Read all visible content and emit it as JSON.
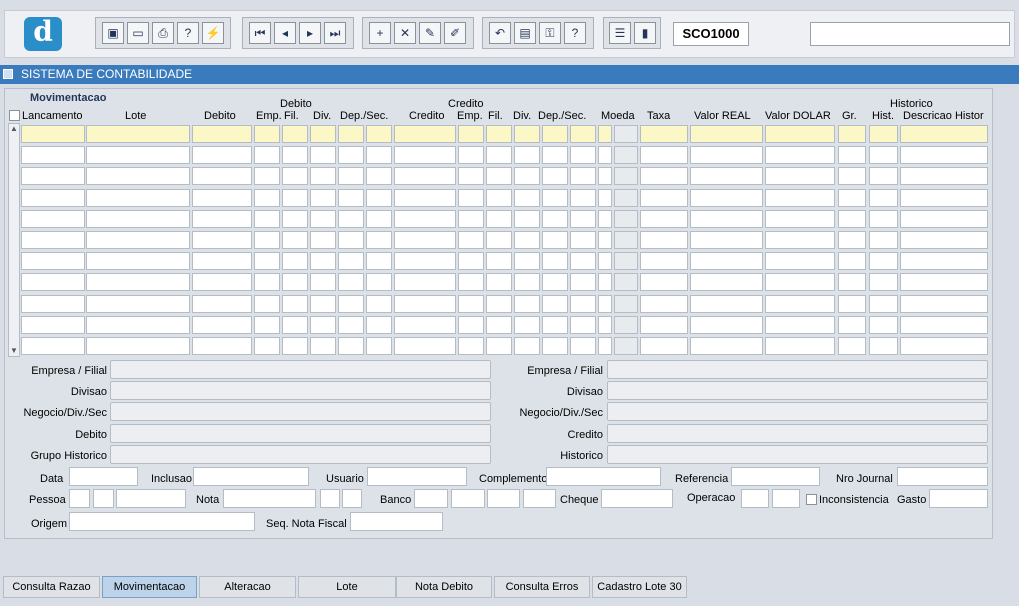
{
  "toolbar": {
    "logo_letter": "d",
    "form_id": "SCO1000",
    "groups": [
      {
        "name": "file-group",
        "buttons": [
          "save-icon",
          "window-icon",
          "print-icon",
          "help-query-icon",
          "magic-wand-icon"
        ]
      },
      {
        "name": "nav-group",
        "buttons": [
          "first-record-icon",
          "prev-record-icon",
          "next-record-icon",
          "last-record-icon"
        ]
      },
      {
        "name": "record-group",
        "buttons": [
          "insert-record-icon",
          "delete-record-icon",
          "edit-record-icon",
          "clear-record-icon"
        ]
      },
      {
        "name": "misc-group",
        "buttons": [
          "undo-icon",
          "clipboard-icon",
          "key-icon",
          "help-icon"
        ]
      },
      {
        "name": "exit-group",
        "buttons": [
          "menu-icon",
          "exit-door-icon"
        ]
      }
    ]
  },
  "title": "SISTEMA DE CONTABILIDADE",
  "section_title": "Movimentacao",
  "grid": {
    "group_headers": {
      "debito": "Debito",
      "credito": "Credito",
      "historico": "Historico"
    },
    "columns": [
      "Lancamento",
      "Lote",
      "Debito",
      "Emp.",
      "Fil.",
      "Div.",
      "Dep./Sec.",
      "Credito",
      "Emp.",
      "Fil.",
      "Div.",
      "Dep./Sec.",
      "Moeda",
      "Taxa",
      "Valor REAL",
      "Valor DOLAR",
      "Gr.",
      "Hist.",
      "Descricao Histor"
    ],
    "row_count": 11
  },
  "details": {
    "left": [
      "Empresa / Filial",
      "Divisao",
      "Negocio/Div./Sec",
      "Debito",
      "Grupo Historico"
    ],
    "right": [
      "Empresa / Filial",
      "Divisao",
      "Negocio/Div./Sec",
      "Credito",
      "Historico"
    ]
  },
  "form": {
    "data": "Data",
    "inclusao": "Inclusao",
    "usuario": "Usuario",
    "complemento": "Complemento",
    "referencia": "Referencia",
    "nro_journal": "Nro Journal",
    "pessoa": "Pessoa",
    "nota": "Nota",
    "banco": "Banco",
    "cheque": "Cheque",
    "operacao": "Operacao",
    "inconsistencia": "Inconsistencia",
    "gasto": "Gasto",
    "origem": "Origem",
    "seq_nota_fiscal": "Seq. Nota Fiscal"
  },
  "tabs": [
    "Consulta Razao",
    "Movimentacao",
    "Alteracao",
    "Lote",
    "Nota Debito",
    "Consulta Erros",
    "Cadastro Lote 30"
  ],
  "active_tab": "Movimentacao"
}
